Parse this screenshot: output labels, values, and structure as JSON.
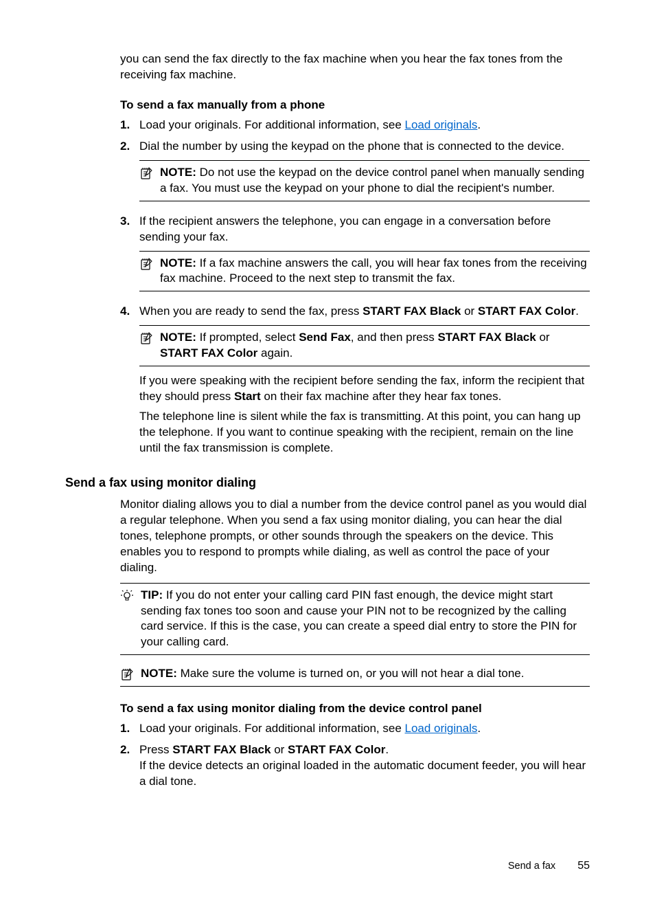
{
  "intro": {
    "p1": "you can send the fax directly to the fax machine when you hear the fax tones from the receiving fax machine."
  },
  "section1": {
    "heading": "To send a fax manually from a phone",
    "items": [
      {
        "num": "1.",
        "textStart": "Load your originals. For additional information, see ",
        "link": "Load originals",
        "textEnd": "."
      },
      {
        "num": "2.",
        "text": "Dial the number by using the keypad on the phone that is connected to the device.",
        "note": {
          "label": "NOTE:",
          "body": "Do not use the keypad on the device control panel when manually sending a fax. You must use the keypad on your phone to dial the recipient's number."
        }
      },
      {
        "num": "3.",
        "text": "If the recipient answers the telephone, you can engage in a conversation before sending your fax.",
        "note": {
          "label": "NOTE:",
          "body": "If a fax machine answers the call, you will hear fax tones from the receiving fax machine. Proceed to the next step to transmit the fax."
        }
      },
      {
        "num": "4.",
        "pre": "When you are ready to send the fax, press ",
        "b1": "START FAX Black",
        "mid": " or ",
        "b2": "START FAX Color",
        "post": ".",
        "note": {
          "label": "NOTE:",
          "n_pre": "If prompted, select ",
          "n_b1": "Send Fax",
          "n_mid1": ", and then press ",
          "n_b2": "START FAX Black",
          "n_mid2": " or ",
          "n_b3": "START FAX Color",
          "n_post": " again."
        },
        "after1_pre": "If you were speaking with the recipient before sending the fax, inform the recipient that they should press ",
        "after1_b": "Start",
        "after1_post": " on their fax machine after they hear fax tones.",
        "after2": "The telephone line is silent while the fax is transmitting. At this point, you can hang up the telephone. If you want to continue speaking with the recipient, remain on the line until the fax transmission is complete."
      }
    ]
  },
  "section2": {
    "heading": "Send a fax using monitor dialing",
    "intro": "Monitor dialing allows you to dial a number from the device control panel as you would dial a regular telephone. When you send a fax using monitor dialing, you can hear the dial tones, telephone prompts, or other sounds through the speakers on the device. This enables you to respond to prompts while dialing, as well as control the pace of your dialing.",
    "tip": {
      "label": "TIP:",
      "body": "If you do not enter your calling card PIN fast enough, the device might start sending fax tones too soon and cause your PIN not to be recognized by the calling card service. If this is the case, you can create a speed dial entry to store the PIN for your calling card."
    },
    "note": {
      "label": "NOTE:",
      "body": "Make sure the volume is turned on, or you will not hear a dial tone."
    },
    "subheading": "To send a fax using monitor dialing from the device control panel",
    "items": [
      {
        "num": "1.",
        "textStart": "Load your originals. For additional information, see ",
        "link": "Load originals",
        "textEnd": "."
      },
      {
        "num": "2.",
        "pre": "Press ",
        "b1": "START FAX Black",
        "mid": " or ",
        "b2": "START FAX Color",
        "post": ".",
        "after": "If the device detects an original loaded in the automatic document feeder, you will hear a dial tone."
      }
    ]
  },
  "footer": {
    "section": "Send a fax",
    "page": "55"
  }
}
